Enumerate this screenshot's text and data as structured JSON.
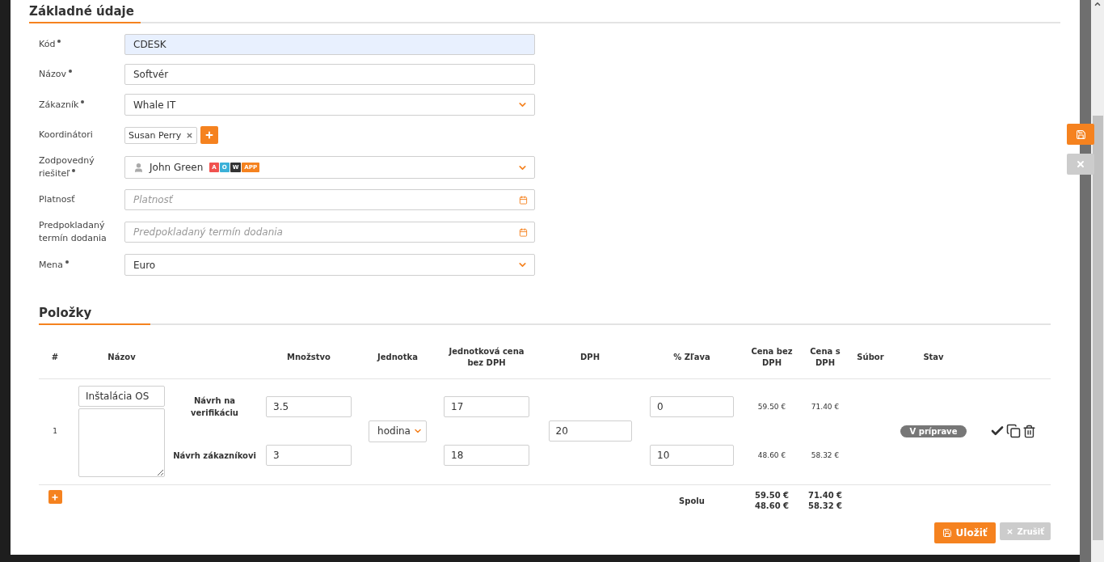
{
  "form": {
    "title": "Základné údaje",
    "fields": [
      {
        "kind": "text",
        "label": "Kód",
        "required": true,
        "value": "CDESK",
        "highlighted": true
      },
      {
        "kind": "text",
        "label": "Názov",
        "required": true,
        "value": "Softvér",
        "highlighted": false
      },
      {
        "kind": "select",
        "label": "Zákazník",
        "required": true,
        "value": "Whale IT"
      },
      {
        "kind": "tags",
        "label": "Koordinátori",
        "required": false,
        "tags": [
          "Susan Perry"
        ]
      },
      {
        "kind": "person",
        "label": "Zodpovedný riešiteľ",
        "required": true,
        "value": "John Green",
        "badges": [
          {
            "label": "A",
            "color": "#f0524f"
          },
          {
            "label": "O",
            "color": "#3bb0d8"
          },
          {
            "label": "W",
            "color": "#333333"
          },
          {
            "label": "APP",
            "color": "#f5821f"
          }
        ]
      },
      {
        "kind": "date",
        "label": "Platnosť",
        "required": false,
        "placeholder": "Platnosť"
      },
      {
        "kind": "date",
        "label": "Predpokladaný termín dodania",
        "required": false,
        "placeholder": "Predpokladaný termín dodania"
      },
      {
        "kind": "select",
        "label": "Mena",
        "required": true,
        "value": "Euro"
      }
    ]
  },
  "items": {
    "title": "Položky",
    "columns": [
      "#",
      "Názov",
      "",
      "Množstvo",
      "Jednotka",
      "Jednotková cena bez DPH",
      "DPH",
      "% Zľava",
      "Cena bez DPH",
      "Cena s DPH",
      "Súbor",
      "Stav",
      ""
    ],
    "rows": [
      {
        "number": "1",
        "name": "Inštalácia OS",
        "unit": "hodina",
        "vat": "20",
        "status": "V príprave",
        "lines": [
          {
            "label": "Návrh na verifikáciu",
            "quantity": "3.5",
            "unit_price": "17",
            "discount": "0",
            "price_without_vat": "59.50 €",
            "price_with_vat": "71.40 €"
          },
          {
            "label": "Návrh zákazníkovi",
            "quantity": "3",
            "unit_price": "18",
            "discount": "10",
            "price_without_vat": "48.60 €",
            "price_with_vat": "58.32 €"
          }
        ]
      }
    ],
    "totals": {
      "label": "Spolu",
      "without_vat": [
        "59.50 €",
        "48.60 €"
      ],
      "with_vat": [
        "71.40 €",
        "58.32 €"
      ]
    }
  },
  "buttons": [
    {
      "label": "Uložiť",
      "kind": "primary"
    },
    {
      "label": "Zrušiť",
      "kind": "secondary"
    }
  ]
}
